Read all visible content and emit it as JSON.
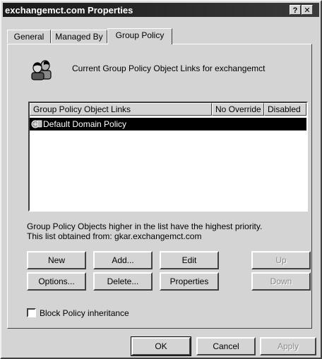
{
  "window": {
    "title": "exchangemct.com Properties",
    "help_button": "?",
    "close_button": "✕"
  },
  "tabs": [
    {
      "label": "General",
      "active": false
    },
    {
      "label": "Managed By",
      "active": false
    },
    {
      "label": "Group Policy",
      "active": true
    }
  ],
  "header": {
    "icon": "group-policy-users-icon",
    "text": "Current Group Policy Object Links for exchangemct"
  },
  "listview": {
    "columns": [
      "Group Policy Object Links",
      "No Override",
      "Disabled"
    ],
    "rows": [
      {
        "name": "Default Domain Policy",
        "no_override": "",
        "disabled": "",
        "selected": true,
        "icon": "gpo-link-icon"
      }
    ]
  },
  "info": {
    "line1": "Group Policy Objects higher in the list have the highest priority.",
    "line2": "This list obtained from: gkar.exchangemct.com"
  },
  "buttons": {
    "new": "New",
    "add": "Add...",
    "edit": "Edit",
    "up": "Up",
    "options": "Options...",
    "delete": "Delete...",
    "properties": "Properties",
    "down": "Down"
  },
  "block_inheritance": {
    "label": "Block Policy inheritance",
    "checked": false
  },
  "dialog_buttons": {
    "ok": "OK",
    "cancel": "Cancel",
    "apply": "Apply"
  }
}
